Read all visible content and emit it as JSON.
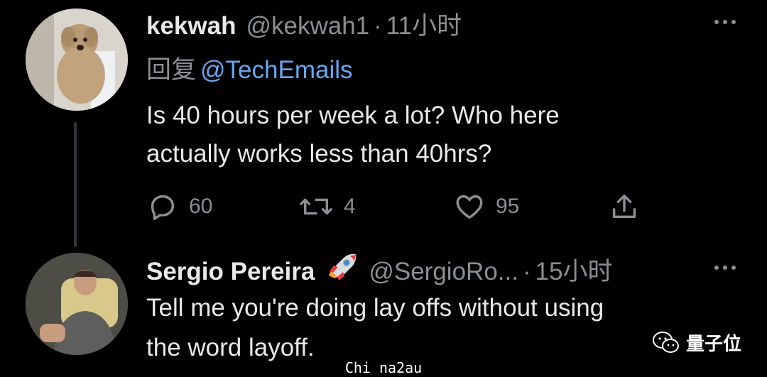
{
  "tweets": [
    {
      "display_name": "kekwah",
      "handle": "@kekwah1",
      "time": "11小时",
      "reply_prefix": "回复",
      "reply_mention": "@TechEmails",
      "text_line1": "Is 40 hours per week a lot? Who here",
      "text_line2": "actually works less than 40hrs?",
      "reply_count": "60",
      "retweet_count": "4",
      "like_count": "95",
      "avatar_icon": "dog-avatar"
    },
    {
      "display_name": "Sergio Pereira",
      "name_emoji": "rocket-emoji",
      "handle": "@SergioRo...",
      "time": "15小时",
      "text_line1": "Tell me you're doing lay offs without using",
      "text_line2": "the word layoff.",
      "avatar_icon": "man-avatar"
    }
  ],
  "separator": "·",
  "watermark": {
    "text": "量子位",
    "icon": "wechat-icon"
  },
  "caption": "Chi na2au",
  "colors": {
    "background": "#000000",
    "text": "#e7e9ea",
    "muted": "#8b8f94",
    "link": "#6aa6f2"
  }
}
